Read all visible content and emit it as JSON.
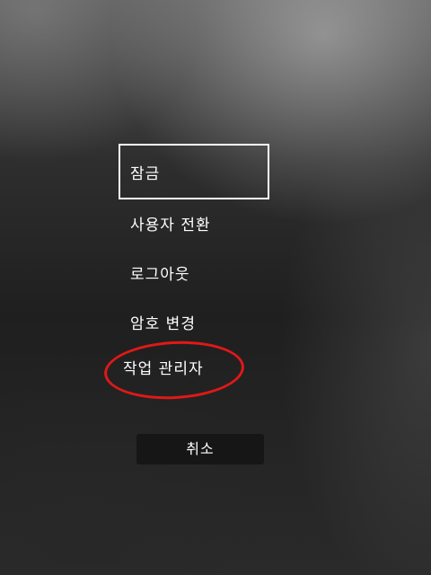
{
  "menu": {
    "items": [
      {
        "label": "잠금",
        "selected": true
      },
      {
        "label": "사용자 전환"
      },
      {
        "label": "로그아웃"
      },
      {
        "label": "암호 변경"
      },
      {
        "label": "작업 관리자"
      }
    ]
  },
  "cancel_label": "취소",
  "annotation": {
    "color": "#e01818"
  },
  "colors": {
    "text": "#ffffff",
    "selection_border": "#ffffff",
    "button_background": "#161616"
  }
}
